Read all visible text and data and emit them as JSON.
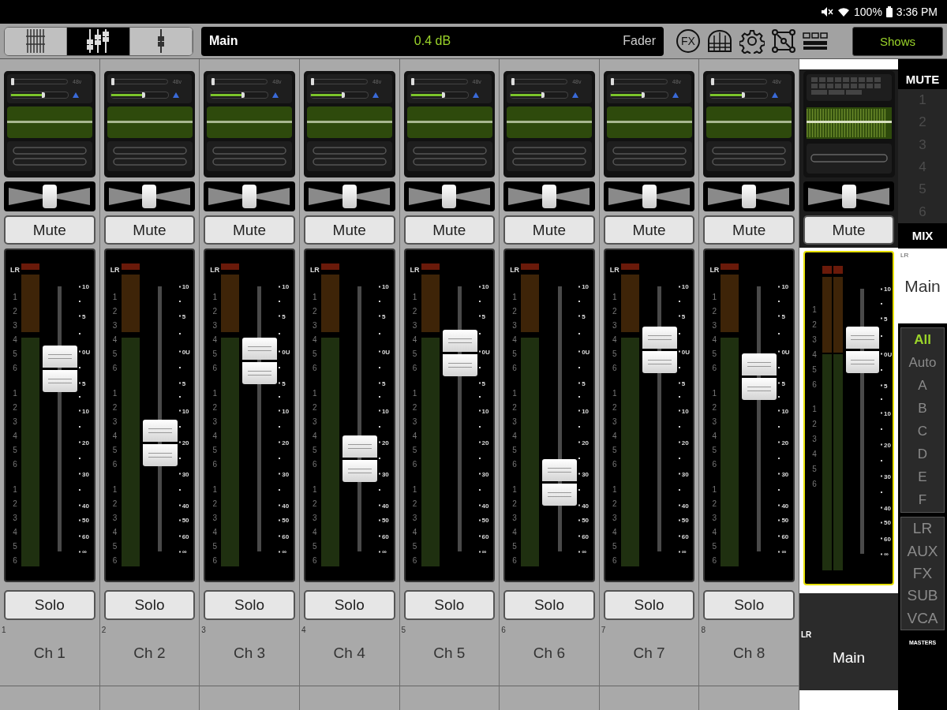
{
  "status_bar": {
    "battery": "100%",
    "time": "3:36 PM"
  },
  "toolbar": {
    "view_modes": [
      {
        "kind": "grid",
        "selected": false
      },
      {
        "kind": "faders",
        "selected": true
      },
      {
        "kind": "single",
        "selected": false
      }
    ],
    "display": {
      "name": "Main",
      "value": "0.4 dB",
      "parameter": "Fader"
    },
    "fx_button": "FX",
    "shows_button": "Shows"
  },
  "channels": [
    {
      "kind": "channel",
      "number": "1",
      "name": "Ch 1",
      "selected": false,
      "phantom": "48v",
      "input": {
        "level": 0.02
      },
      "gain": {
        "level": 0.6
      },
      "pan": {
        "level": 0.5
      },
      "mute": {
        "label": "Mute",
        "on": false
      },
      "meter_label": "LR",
      "bus_groups": [
        [
          "1",
          "2",
          "3",
          "4",
          "5",
          "6"
        ],
        [
          "1",
          "2",
          "3",
          "4",
          "5",
          "6"
        ],
        [
          "1",
          "2",
          "3",
          "4",
          "5",
          "6"
        ]
      ],
      "scale": [
        "10",
        "5",
        "0U",
        "5",
        "10",
        "20",
        "30",
        "40",
        "50",
        "60",
        "∞"
      ],
      "fader": {
        "level": 0.69
      },
      "solo": {
        "label": "Solo",
        "on": false
      }
    },
    {
      "kind": "channel",
      "number": "2",
      "name": "Ch 2",
      "selected": false,
      "phantom": "48v",
      "input": {
        "level": 0.02
      },
      "gain": {
        "level": 0.6
      },
      "pan": {
        "level": 0.5
      },
      "mute": {
        "label": "Mute",
        "on": false
      },
      "meter_label": "LR",
      "bus_groups": [
        [
          "1",
          "2",
          "3",
          "4",
          "5",
          "6"
        ],
        [
          "1",
          "2",
          "3",
          "4",
          "5",
          "6"
        ],
        [
          "1",
          "2",
          "3",
          "4",
          "5",
          "6"
        ]
      ],
      "scale": [
        "10",
        "5",
        "0U",
        "5",
        "10",
        "20",
        "30",
        "40",
        "50",
        "60",
        "∞"
      ],
      "fader": {
        "level": 0.41
      },
      "solo": {
        "label": "Solo",
        "on": false
      }
    },
    {
      "kind": "channel",
      "number": "3",
      "name": "Ch 3",
      "selected": false,
      "phantom": "48v",
      "input": {
        "level": 0.02
      },
      "gain": {
        "level": 0.6
      },
      "pan": {
        "level": 0.5
      },
      "mute": {
        "label": "Mute",
        "on": false
      },
      "meter_label": "LR",
      "bus_groups": [
        [
          "1",
          "2",
          "3",
          "4",
          "5",
          "6"
        ],
        [
          "1",
          "2",
          "3",
          "4",
          "5",
          "6"
        ],
        [
          "1",
          "2",
          "3",
          "4",
          "5",
          "6"
        ]
      ],
      "scale": [
        "10",
        "5",
        "0U",
        "5",
        "10",
        "20",
        "30",
        "40",
        "50",
        "60",
        "∞"
      ],
      "fader": {
        "level": 0.72
      },
      "solo": {
        "label": "Solo",
        "on": false
      }
    },
    {
      "kind": "channel",
      "number": "4",
      "name": "Ch 4",
      "selected": false,
      "phantom": "48v",
      "input": {
        "level": 0.02
      },
      "gain": {
        "level": 0.6
      },
      "pan": {
        "level": 0.5
      },
      "mute": {
        "label": "Mute",
        "on": false
      },
      "meter_label": "LR",
      "bus_groups": [
        [
          "1",
          "2",
          "3",
          "4",
          "5",
          "6"
        ],
        [
          "1",
          "2",
          "3",
          "4",
          "5",
          "6"
        ],
        [
          "1",
          "2",
          "3",
          "4",
          "5",
          "6"
        ]
      ],
      "scale": [
        "10",
        "5",
        "0U",
        "5",
        "10",
        "20",
        "30",
        "40",
        "50",
        "60",
        "∞"
      ],
      "fader": {
        "level": 0.35
      },
      "solo": {
        "label": "Solo",
        "on": false
      }
    },
    {
      "kind": "channel",
      "number": "5",
      "name": "Ch 5",
      "selected": false,
      "phantom": "48v",
      "input": {
        "level": 0.02
      },
      "gain": {
        "level": 0.6
      },
      "pan": {
        "level": 0.5
      },
      "mute": {
        "label": "Mute",
        "on": false
      },
      "meter_label": "LR",
      "bus_groups": [
        [
          "1",
          "2",
          "3",
          "4",
          "5",
          "6"
        ],
        [
          "1",
          "2",
          "3",
          "4",
          "5",
          "6"
        ],
        [
          "1",
          "2",
          "3",
          "4",
          "5",
          "6"
        ]
      ],
      "scale": [
        "10",
        "5",
        "0U",
        "5",
        "10",
        "20",
        "30",
        "40",
        "50",
        "60",
        "∞"
      ],
      "fader": {
        "level": 0.75
      },
      "solo": {
        "label": "Solo",
        "on": false
      }
    },
    {
      "kind": "channel",
      "number": "6",
      "name": "Ch 6",
      "selected": false,
      "phantom": "48v",
      "input": {
        "level": 0.02
      },
      "gain": {
        "level": 0.6
      },
      "pan": {
        "level": 0.5
      },
      "mute": {
        "label": "Mute",
        "on": false
      },
      "meter_label": "LR",
      "bus_groups": [
        [
          "1",
          "2",
          "3",
          "4",
          "5",
          "6"
        ],
        [
          "1",
          "2",
          "3",
          "4",
          "5",
          "6"
        ],
        [
          "1",
          "2",
          "3",
          "4",
          "5",
          "6"
        ]
      ],
      "scale": [
        "10",
        "5",
        "0U",
        "5",
        "10",
        "20",
        "30",
        "40",
        "50",
        "60",
        "∞"
      ],
      "fader": {
        "level": 0.26
      },
      "solo": {
        "label": "Solo",
        "on": false
      }
    },
    {
      "kind": "channel",
      "number": "7",
      "name": "Ch 7",
      "selected": false,
      "phantom": "48v",
      "input": {
        "level": 0.02
      },
      "gain": {
        "level": 0.6
      },
      "pan": {
        "level": 0.5
      },
      "mute": {
        "label": "Mute",
        "on": false
      },
      "meter_label": "LR",
      "bus_groups": [
        [
          "1",
          "2",
          "3",
          "4",
          "5",
          "6"
        ],
        [
          "1",
          "2",
          "3",
          "4",
          "5",
          "6"
        ],
        [
          "1",
          "2",
          "3",
          "4",
          "5",
          "6"
        ]
      ],
      "scale": [
        "10",
        "5",
        "0U",
        "5",
        "10",
        "20",
        "30",
        "40",
        "50",
        "60",
        "∞"
      ],
      "fader": {
        "level": 0.76
      },
      "solo": {
        "label": "Solo",
        "on": false
      }
    },
    {
      "kind": "channel",
      "number": "8",
      "name": "Ch 8",
      "selected": false,
      "phantom": "48v",
      "input": {
        "level": 0.02
      },
      "gain": {
        "level": 0.6
      },
      "pan": {
        "level": 0.5
      },
      "mute": {
        "label": "Mute",
        "on": false
      },
      "meter_label": "LR",
      "bus_groups": [
        [
          "1",
          "2",
          "3",
          "4",
          "5",
          "6"
        ],
        [
          "1",
          "2",
          "3",
          "4",
          "5",
          "6"
        ],
        [
          "1",
          "2",
          "3",
          "4",
          "5",
          "6"
        ]
      ],
      "scale": [
        "10",
        "5",
        "0U",
        "5",
        "10",
        "20",
        "30",
        "40",
        "50",
        "60",
        "∞"
      ],
      "fader": {
        "level": 0.66
      },
      "solo": {
        "label": "Solo",
        "on": false
      }
    }
  ],
  "main_strip": {
    "kind": "master",
    "number": "LR",
    "name": "Main",
    "selected": true,
    "pan": {
      "level": 0.5
    },
    "mute": {
      "label": "Mute",
      "on": false
    },
    "bus_groups": [
      [
        "1",
        "2",
        "3",
        "4",
        "5",
        "6"
      ],
      [
        "1",
        "2",
        "3",
        "4",
        "5",
        "6"
      ]
    ],
    "scale": [
      "10",
      "5",
      "0U",
      "5",
      "10",
      "20",
      "30",
      "40",
      "50",
      "60",
      "∞"
    ],
    "fader": {
      "level": 0.77
    }
  },
  "sidebar": {
    "mute_title": "MUTE",
    "mute_groups": [
      {
        "label": "1",
        "on": false
      },
      {
        "label": "2",
        "on": false
      },
      {
        "label": "3",
        "on": false
      },
      {
        "label": "4",
        "on": false
      },
      {
        "label": "5",
        "on": false
      },
      {
        "label": "6",
        "on": false
      }
    ],
    "mix_title": "MIX",
    "mix": {
      "bus": "LR",
      "name": "Main"
    },
    "filters": [
      {
        "label": "All",
        "selected": true
      },
      {
        "label": "Auto",
        "selected": false
      },
      {
        "label": "A",
        "selected": false
      },
      {
        "label": "B",
        "selected": false
      },
      {
        "label": "C",
        "selected": false
      },
      {
        "label": "D",
        "selected": false
      },
      {
        "label": "E",
        "selected": false
      },
      {
        "label": "F",
        "selected": false
      }
    ],
    "masters": [
      {
        "label": "LR",
        "selected": false
      },
      {
        "label": "AUX",
        "selected": false
      },
      {
        "label": "FX",
        "selected": false
      },
      {
        "label": "SUB",
        "selected": false
      },
      {
        "label": "VCA",
        "selected": false
      }
    ],
    "masters_title": "MASTERS"
  }
}
